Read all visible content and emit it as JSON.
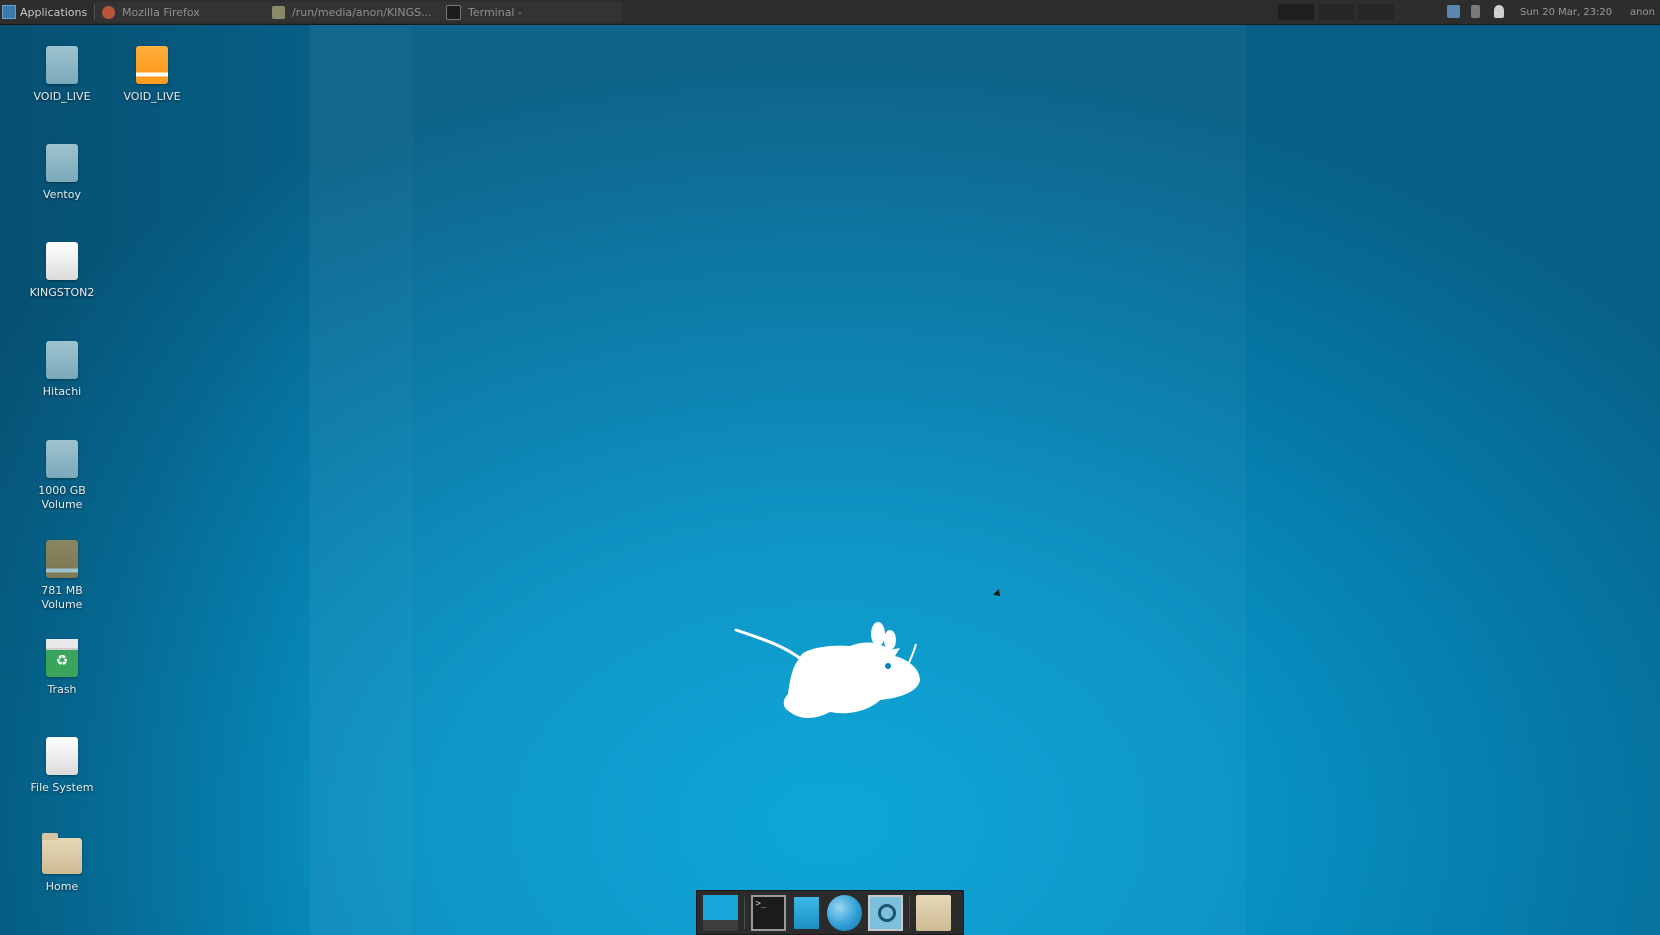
{
  "top_panel": {
    "applications_label": "Applications",
    "tasks": [
      {
        "label": "Mozilla Firefox",
        "icon": "firefox-icon"
      },
      {
        "label": "/run/media/anon/KINGS...",
        "icon": "folder-icon"
      },
      {
        "label": "Terminal -",
        "icon": "terminal-icon"
      }
    ],
    "clock": "Sun 20 Mar, 23:20",
    "user": "anon"
  },
  "desktop_icons": [
    {
      "label": "VOID_LIVE",
      "icon": "drive-icon"
    },
    {
      "label": "VOID_LIVE",
      "icon": "optical-drive-icon"
    },
    {
      "label": "Ventoy",
      "icon": "drive-icon"
    },
    {
      "label": "KINGSTON2",
      "icon": "removable-drive-icon"
    },
    {
      "label": "Hitachi",
      "icon": "drive-icon"
    },
    {
      "label": "1000 GB Volume",
      "icon": "drive-icon"
    },
    {
      "label": "781 MB Volume",
      "icon": "drive-icon"
    },
    {
      "label": "Trash",
      "icon": "trash-icon"
    },
    {
      "label": "File System",
      "icon": "filesystem-icon"
    },
    {
      "label": "Home",
      "icon": "home-folder-icon"
    }
  ],
  "dock": {
    "items": [
      "show-desktop-icon",
      "terminal-icon",
      "file-manager-icon",
      "web-browser-icon",
      "app-finder-icon",
      "folder-icon"
    ],
    "terminal_glyph": ">_"
  },
  "colors": {
    "desktop_bg": "#0792c4",
    "panel_bg": "#2d2d2d",
    "accent": "#1aa6d8"
  }
}
